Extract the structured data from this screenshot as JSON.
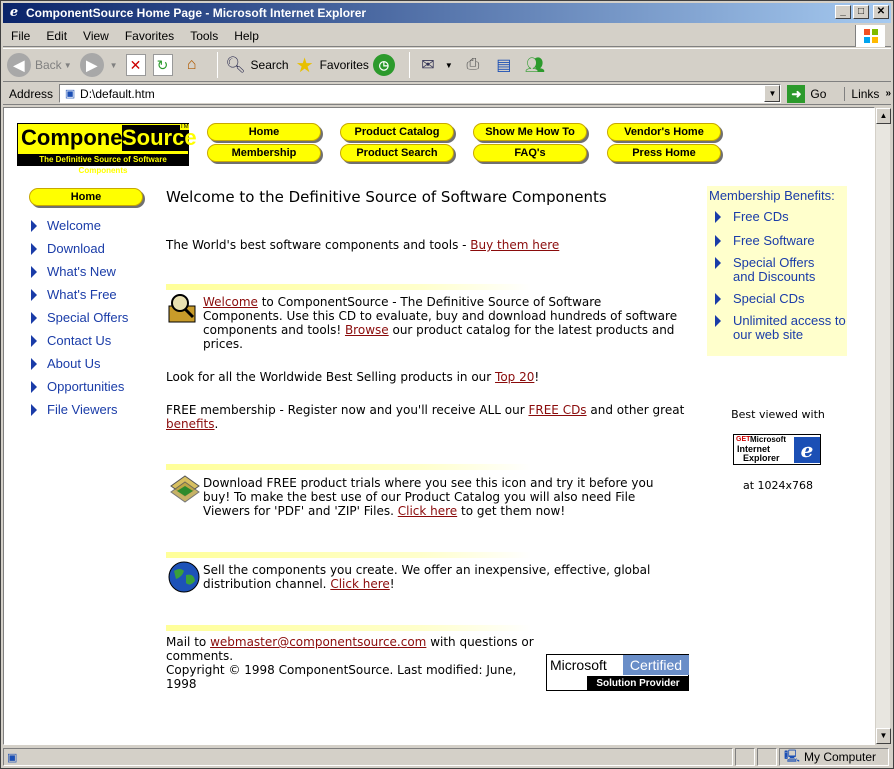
{
  "window": {
    "title": "ComponentSource Home Page - Microsoft Internet Explorer",
    "buttons": {
      "minimize": "_",
      "maximize": "□",
      "close": "✕"
    }
  },
  "menubar": [
    "File",
    "Edit",
    "View",
    "Favorites",
    "Tools",
    "Help"
  ],
  "toolbar": {
    "back": "Back",
    "search": "Search",
    "favorites": "Favorites"
  },
  "addressbar": {
    "label": "Address",
    "url": "D:\\default.htm",
    "go": "Go",
    "links": "Links"
  },
  "page": {
    "logo": {
      "word1": "Component",
      "word2": "Source",
      "tm": "TM",
      "tagline": "The Definitive Source of Software Components"
    },
    "topnav": [
      [
        "Home",
        "Product Catalog",
        "Show Me How To",
        "Vendor's Home"
      ],
      [
        "Membership",
        "Product Search",
        "FAQ's",
        "Press Home"
      ]
    ],
    "home_pill": "Home",
    "sidenav": [
      "Welcome",
      "Download",
      "What's New",
      "What's Free",
      "Special Offers",
      "Contact Us",
      "About Us",
      "Opportunities",
      "File Viewers"
    ],
    "heading": "Welcome to the Definitive Source of Software Components",
    "tagline_text": "The World's best software components and tools - ",
    "tagline_link": "Buy them here",
    "intro": {
      "link1": "Welcome",
      "text1": " to ComponentSource - The Definitive Source of Software Components. Use this CD to evaluate, buy and download hundreds of software components and tools! ",
      "link2": "Browse",
      "text2": " our product catalog for the latest products and prices."
    },
    "top20": {
      "text": "Look for all the Worldwide Best Selling products in our ",
      "link": "Top 20",
      "end": "!"
    },
    "membership": {
      "text1": "FREE membership - Register now and you'll receive ALL our ",
      "link1": "FREE CDs",
      "text2": " and other great ",
      "link2": "benefits",
      "end": "."
    },
    "download": {
      "text1": "Download FREE product trials where you see this icon and try it before you buy! To make the best use of our Product Catalog you will also need File Viewers for 'PDF' and 'ZIP' Files. ",
      "link": "Click here",
      "text2": " to get them now!"
    },
    "sell": {
      "text1": "Sell the components you create. We offer an inexpensive, effective, global distribution channel. ",
      "link": "Click here",
      "end": "!"
    },
    "footer": {
      "mail_text": "Mail to ",
      "mail_link": "webmaster@componentsource.com",
      "mail_end": " with questions or comments.",
      "copyright": "Copyright © 1998 ComponentSource. Last modified: June, 1998"
    },
    "benefits": {
      "heading": "Membership Benefits:",
      "items": [
        "Free CDs",
        "Free Software",
        "Special Offers and Discounts",
        "Special CDs",
        "Unlimited access to our web site"
      ]
    },
    "best_viewed": "Best viewed with",
    "ie_badge": {
      "get": "GET",
      "ms": "Microsoft",
      "line1": "Internet",
      "line2": "Explorer",
      "e": "e"
    },
    "resolution": "at 1024x768",
    "ms_cert": {
      "ms": "Microsoft",
      "cert": "Certified",
      "sp": "Solution Provider"
    }
  },
  "status": {
    "zone": "My Computer"
  }
}
